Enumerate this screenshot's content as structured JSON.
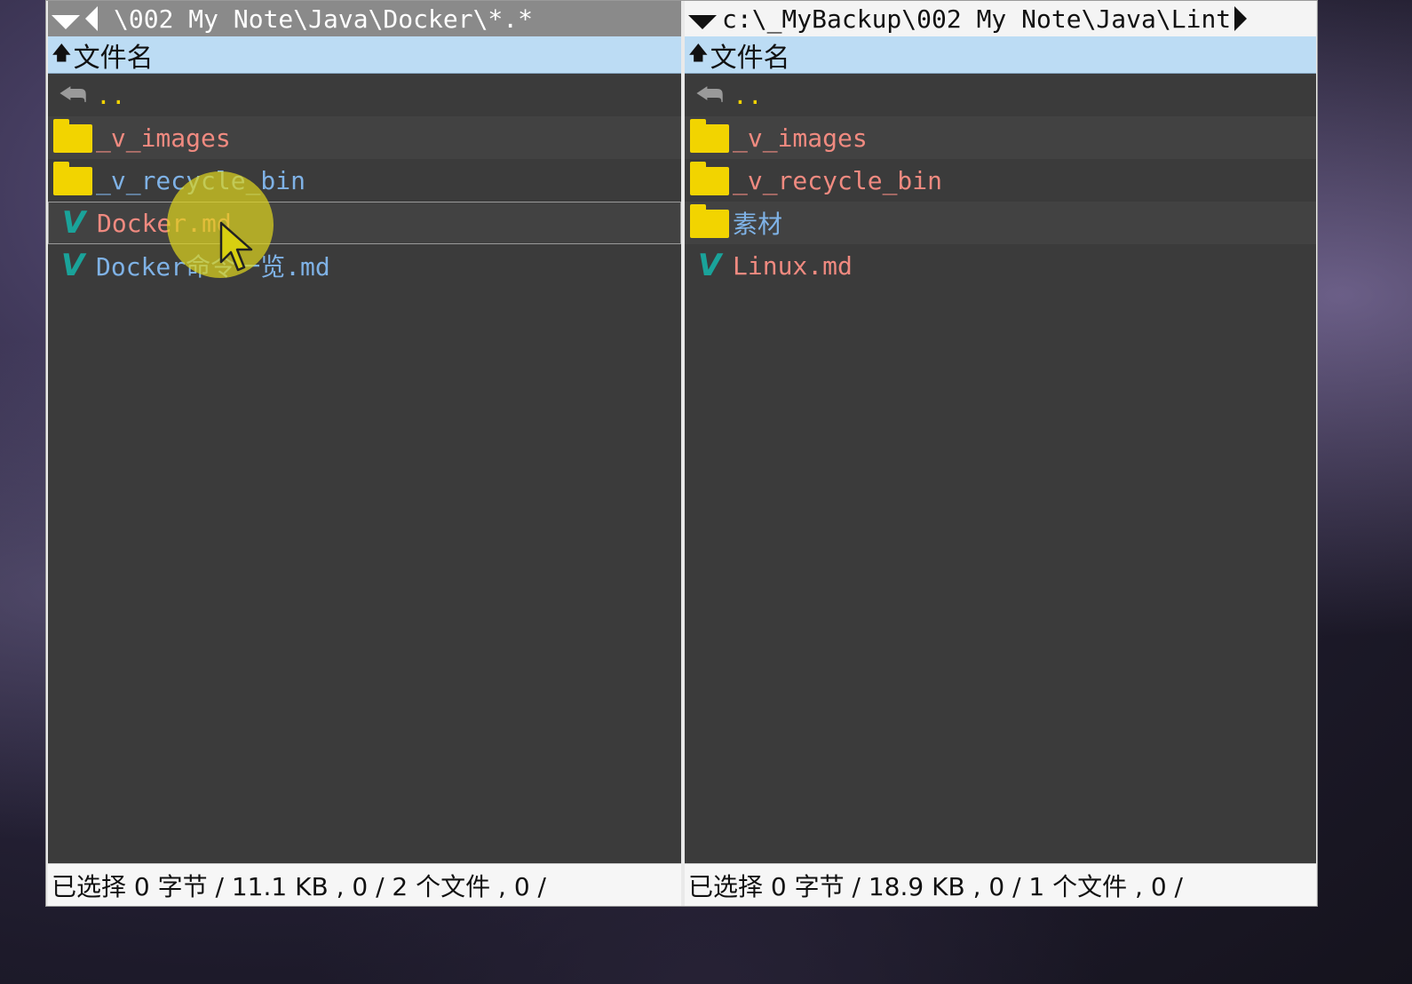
{
  "left_panel": {
    "path": "\\002 My Note\\Java\\Docker\\*.*",
    "column_header": "文件名",
    "items": [
      {
        "name": "..",
        "type": "updir"
      },
      {
        "name": "_v_images",
        "type": "folder"
      },
      {
        "name": "_v_recycle_bin",
        "type": "folder"
      },
      {
        "name": "Docker.md",
        "type": "file"
      },
      {
        "name": "Docker命令一览.md",
        "type": "file"
      }
    ],
    "status": "已选择 0 字节 / 11.1 KB , 0 / 2 个文件 , 0 /"
  },
  "right_panel": {
    "path": "c:\\_MyBackup\\002 My Note\\Java\\Lint",
    "column_header": "文件名",
    "items": [
      {
        "name": "..",
        "type": "updir"
      },
      {
        "name": "_v_images",
        "type": "folder"
      },
      {
        "name": "_v_recycle_bin",
        "type": "folder"
      },
      {
        "name": "素材",
        "type": "folder"
      },
      {
        "name": "Linux.md",
        "type": "file"
      }
    ],
    "status": "已选择 0 字节 / 18.9 KB , 0 / 1 个文件 , 0 /"
  },
  "colors": {
    "panel_bg": "#3b3b3b",
    "header_bg": "#bcdcf4",
    "folder_icon": "#f2d400",
    "updir_dots": "#f2d200",
    "name_red": "#f08a80",
    "name_blue": "#7fb2e6",
    "vnote_icon": "#1aa39a",
    "cursor_halo": "#dcd21e"
  },
  "icons": {
    "updir": "up-directory-icon",
    "folder": "folder-icon",
    "file": "vnote-file-icon",
    "sort": "sort-ascending-icon",
    "history_dropdown": "chevron-down-icon",
    "history_back": "triangle-left-icon",
    "history_forward": "triangle-right-icon"
  }
}
